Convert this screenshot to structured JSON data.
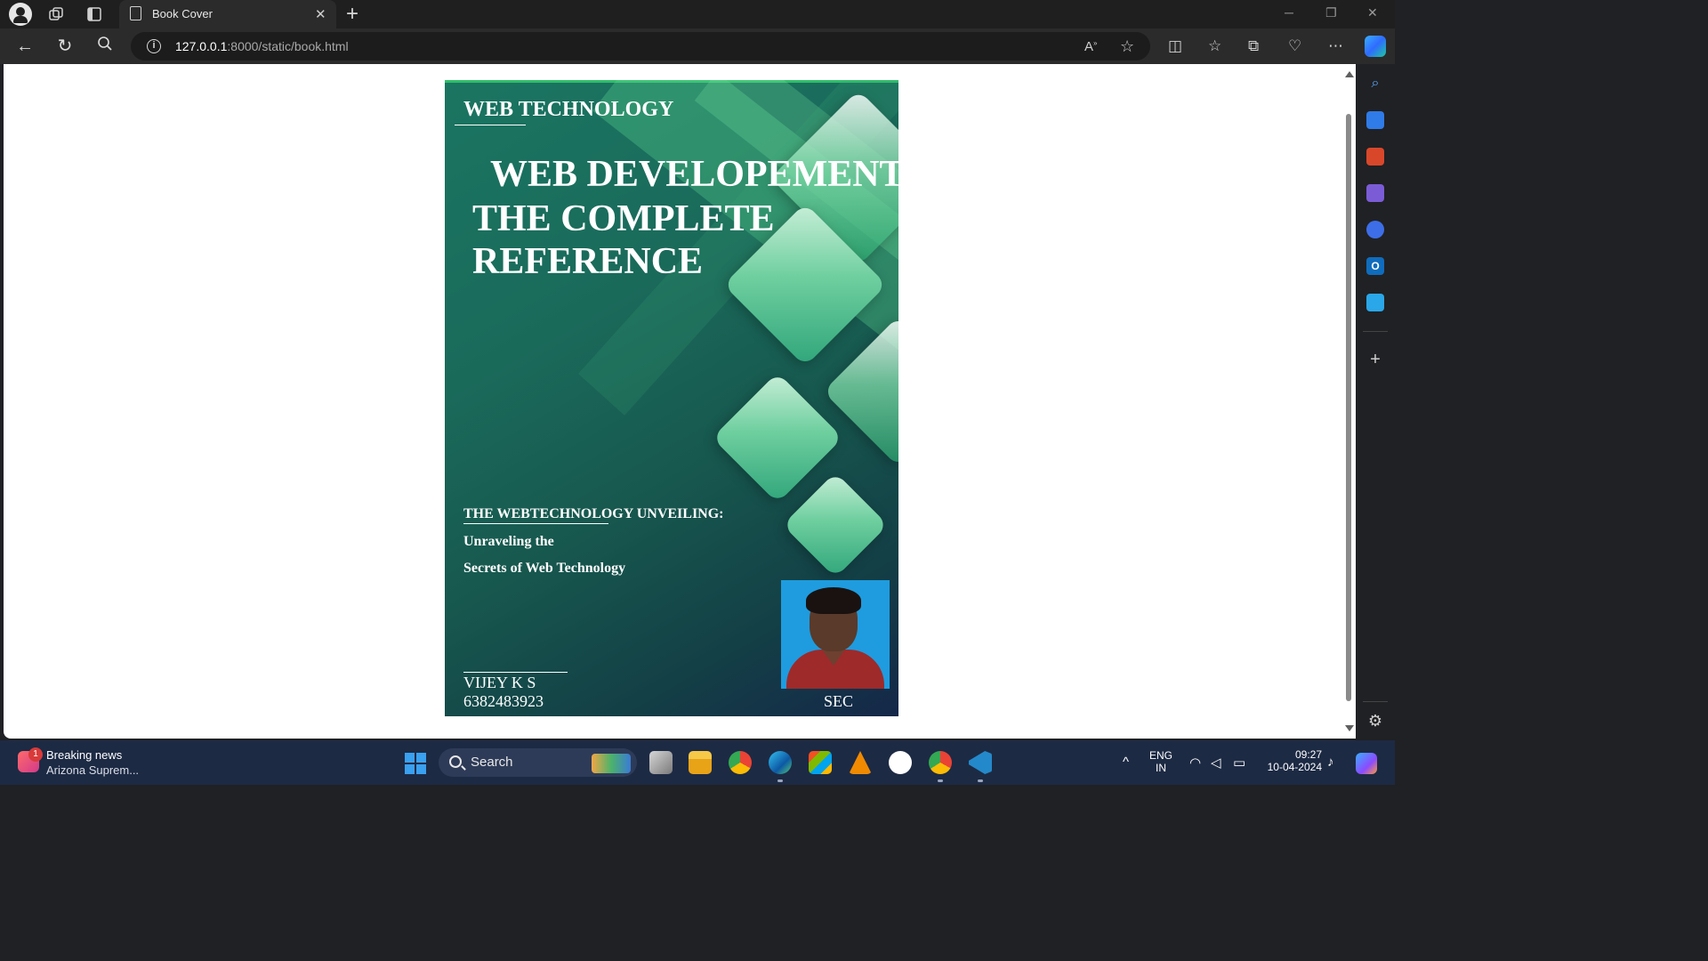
{
  "browser": {
    "tab_title": "Book Cover",
    "url_host": "127.0.0.1",
    "url_path": ":8000/static/book.html",
    "new_tab": "+",
    "tab_close": "✕"
  },
  "cover": {
    "header": "WEB TECHNOLOGY",
    "title_line1": "WEB DEVELOPEMENT",
    "title_line2": "THE COMPLETE",
    "title_line3": "REFERENCE",
    "subtitle_heading": "THE WEBTECHNOLOGY UNVEILING:",
    "subtitle_line1": "Unraveling the",
    "subtitle_line2": "Secrets of Web Technology",
    "author_name": "VIJEY K S",
    "author_phone": "6382483923",
    "institution": "SEC"
  },
  "taskbar": {
    "news_badge": "1",
    "news_title": "Breaking news",
    "news_subtitle": "Arizona Suprem...",
    "search_label": "Search",
    "lang_line1": "ENG",
    "lang_line2": "IN",
    "time": "09:27",
    "date": "10-04-2024"
  },
  "colors": {
    "cover_gradient_top": "#1a7561",
    "cover_gradient_bottom": "#152749",
    "diamond_light": "#c9efd9",
    "diamond_mid": "#6fcf9f",
    "photo_bg": "#1e9cdf",
    "taskbar_bg": "#1d2a44"
  },
  "icons": {
    "back": "back-arrow-icon",
    "refresh": "refresh-icon",
    "search": "search-icon",
    "info": "info-icon",
    "read_aloud": "read-aloud-icon",
    "favorite": "star-icon",
    "split": "split-screen-icon",
    "favorites": "favorites-icon",
    "collections": "collections-icon",
    "health": "browser-essentials-icon",
    "more": "more-icon",
    "copilot": "copilot-icon"
  }
}
